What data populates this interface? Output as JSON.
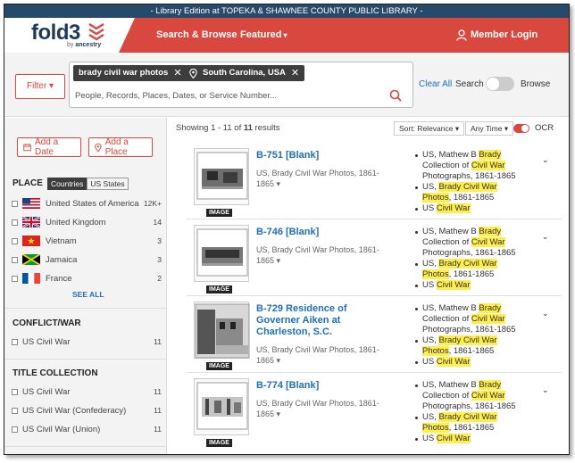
{
  "banner": "- Library Edition at TOPEKA & SHAWNEE COUNTY PUBLIC LIBRARY -",
  "logo": {
    "name": "fold3",
    "by": "by",
    "brand": "ancestry"
  },
  "nav": {
    "search_browse": "Search & Browse",
    "featured": "Featured",
    "member_login": "Member Login"
  },
  "search": {
    "filter_label": "Filter",
    "chips": [
      "brady civil war photos",
      "South Carolina, USA"
    ],
    "placeholder": "People, Records, Places, Dates, or Service Number...",
    "clear_all": "Clear All",
    "mode_search": "Search",
    "mode_browse": "Browse"
  },
  "sidebar": {
    "add_date": "Add a Date",
    "add_place": "Add a Place",
    "place_title": "PLACE",
    "place_tabs": [
      "Countries",
      "US States"
    ],
    "places": [
      {
        "label": "United States of America",
        "count": "12K+",
        "flag": "us-flag"
      },
      {
        "label": "United Kingdom",
        "count": "14",
        "flag": "uk-flag"
      },
      {
        "label": "Vietnam",
        "count": "3",
        "flag": "vietnam-flag"
      },
      {
        "label": "Jamaica",
        "count": "3",
        "flag": "jamaica-flag"
      },
      {
        "label": "France",
        "count": "2",
        "flag": "france-flag"
      }
    ],
    "see_all": "SEE ALL",
    "conflict_title": "CONFLICT/WAR",
    "conflicts": [
      {
        "label": "US Civil War",
        "count": "11"
      }
    ],
    "title_collection_title": "TITLE COLLECTION",
    "collections": [
      {
        "label": "US Civil War",
        "count": "11"
      },
      {
        "label": "US Civil War (Confederacy)",
        "count": "11"
      },
      {
        "label": "US Civil War (Union)",
        "count": "11"
      }
    ]
  },
  "results_header": {
    "showing": "Showing 1 - 11 of ",
    "total": "11",
    "showing_suffix": " results",
    "sort": "Sort: Relevance",
    "time": "Any Time",
    "ocr": "OCR"
  },
  "results": [
    {
      "title": "B-751 [Blank]",
      "subtitle": "US, Brady Civil War Photos, 1861-1865",
      "badge": "IMAGE"
    },
    {
      "title": "B-746 [Blank]",
      "subtitle": "US, Brady Civil War Photos, 1861-1865",
      "badge": "IMAGE"
    },
    {
      "title": "B-729 Residence of Governer Aiken at Charleston, S.C.",
      "subtitle": "US, Brady Civil War Photos, 1861-1865",
      "badge": "IMAGE"
    },
    {
      "title": "B-774 [Blank]",
      "subtitle": "US, Brady Civil War Photos, 1861-1865",
      "badge": "IMAGE"
    }
  ],
  "collection_lines": {
    "a_pre": "US, Mathew B ",
    "a_hl1": "Brady",
    "a_mid": " Collection of ",
    "a_hl2": "Civil War",
    "a_post": " Photographs, 1861-1865",
    "b_pre": "US, ",
    "b_hl": "Brady Civil War Photos",
    "b_post": ", 1861-1865",
    "c_pre": "US ",
    "c_hl": "Civil War"
  },
  "colors": {
    "brand_red": "#d8483f",
    "banner_blue": "#274a6b",
    "link_blue": "#1e6fb8",
    "highlight": "#ffee4d"
  }
}
